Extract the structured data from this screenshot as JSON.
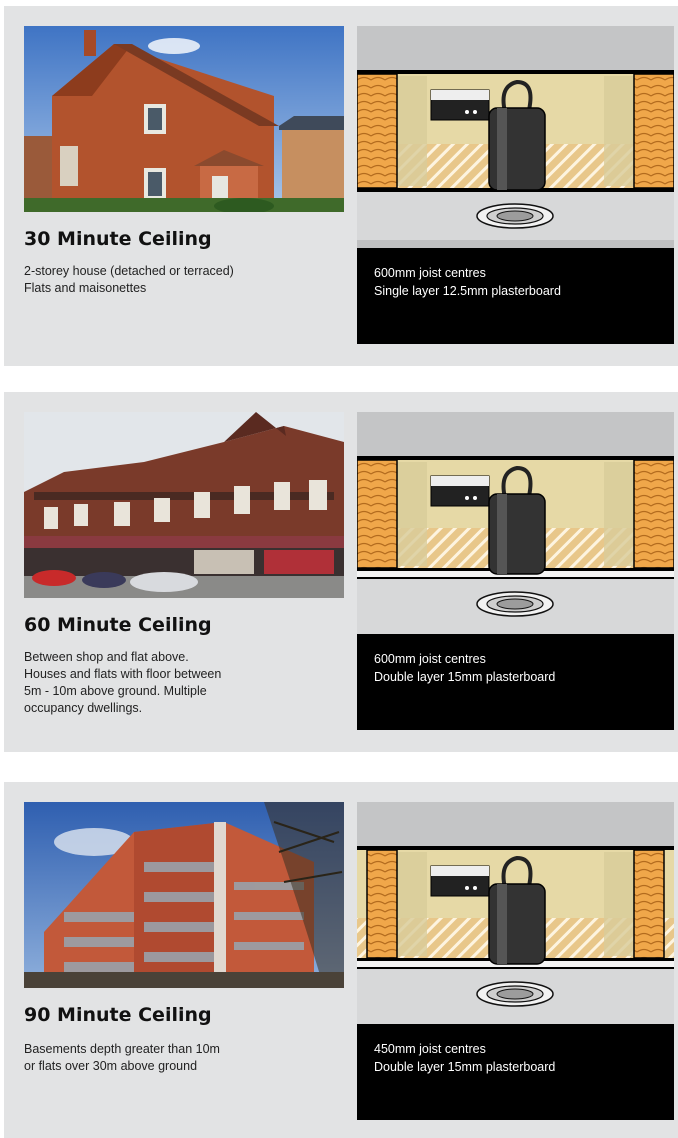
{
  "sections": [
    {
      "title": "30 Minute Ceiling",
      "description_lines": [
        "2-storey house (detached or terraced)",
        "Flats and maisonettes"
      ],
      "spec_lines": [
        "600mm joist centres",
        "Single layer 12.5mm plasterboard"
      ]
    },
    {
      "title": "60 Minute Ceiling",
      "description_lines": [
        "Between shop and flat above.",
        "Houses and flats with floor between",
        "5m - 10m above ground. Multiple",
        "occupancy dwellings."
      ],
      "spec_lines": [
        "600mm joist centres",
        "Double layer 15mm plasterboard"
      ]
    },
    {
      "title": "90 Minute Ceiling",
      "description_lines": [
        "Basements depth greater than 10m",
        "or flats over 30m above ground"
      ],
      "spec_lines": [
        "450mm joist centres",
        "Double layer 15mm plasterboard"
      ]
    }
  ],
  "colors": {
    "panel_bg": "#e2e3e4",
    "diagram_bg": "#000000",
    "joist_orange": "#f0a74a",
    "insulation_tan": "#e8c78a",
    "plasterboard_grey": "#d7d8d9"
  },
  "icons": [
    "downlight-fitting-icon",
    "driver-box-icon",
    "joist-icon"
  ]
}
